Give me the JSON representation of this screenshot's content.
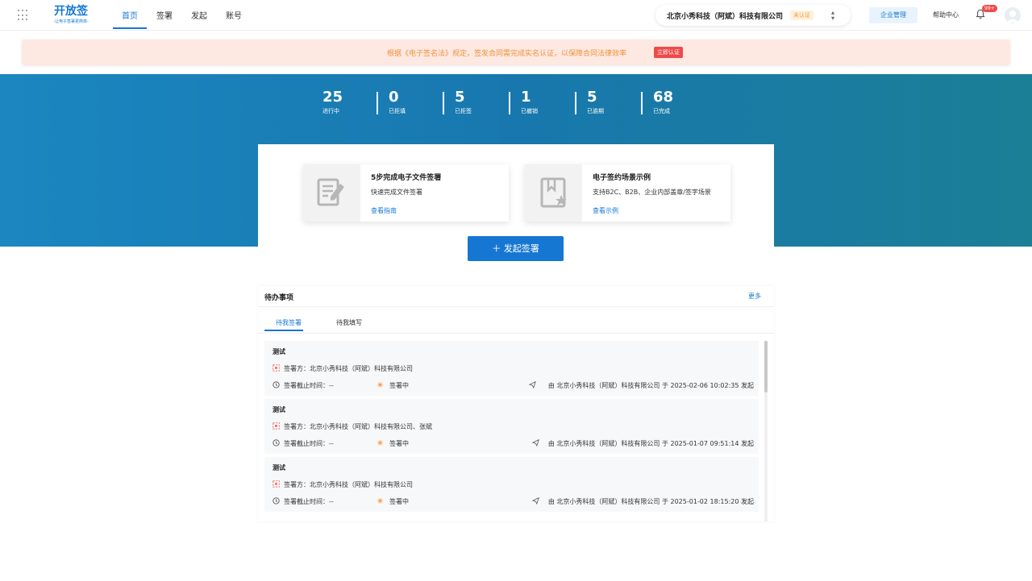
{
  "logo": {
    "main": "开放签",
    "sub": "-让电子签署更简单-"
  },
  "nav": {
    "tabs": [
      "首页",
      "签署",
      "发起",
      "账号"
    ]
  },
  "company": {
    "name": "北京小秀科技（阿斌）科技有限公司",
    "status": "未认证"
  },
  "header": {
    "enterprise_label": "企业管理",
    "help_label": "帮助中心",
    "notification_count": "99+"
  },
  "notice": {
    "text": "根据《电子签名法》规定，签发合同需完成实名认证，以保障合同法律效率",
    "button": "立即认证"
  },
  "stats": [
    {
      "value": "25",
      "label": "进行中"
    },
    {
      "value": "0",
      "label": "已拒填"
    },
    {
      "value": "5",
      "label": "已拒签"
    },
    {
      "value": "1",
      "label": "已撤销"
    },
    {
      "value": "5",
      "label": "已逾期"
    },
    {
      "value": "68",
      "label": "已完成"
    }
  ],
  "guides": [
    {
      "title": "5步完成电子文件签署",
      "desc": "快速完成文件签署",
      "link": "查看指南"
    },
    {
      "title": "电子签约场景示例",
      "desc": "支持B2C、B2B、企业内部盖章/签字场景",
      "link": "查看示例"
    }
  ],
  "start_button": "发起签署",
  "pending": {
    "title": "待办事项",
    "more": "更多",
    "tabs": [
      "待我签署",
      "待我填写"
    ],
    "items": [
      {
        "name": "测试",
        "signers": "签署方：北京小秀科技（阿斌）科技有限公司",
        "deadline": "签署截止时间：--",
        "status": "签署中",
        "initiator": "由 北京小秀科技（阿斌）科技有限公司 于 2025-02-06 10:02:35 发起"
      },
      {
        "name": "测试",
        "signers": "签署方：北京小秀科技（阿斌）科技有限公司、张斌",
        "deadline": "签署截止时间：--",
        "status": "签署中",
        "initiator": "由 北京小秀科技（阿斌）科技有限公司 于 2025-01-07 09:51:14 发起"
      },
      {
        "name": "测试",
        "signers": "签署方：北京小秀科技（阿斌）科技有限公司",
        "deadline": "签署截止时间：--",
        "status": "签署中",
        "initiator": "由 北京小秀科技（阿斌）科技有限公司 于 2025-01-02 18:15:20 发起"
      }
    ]
  }
}
